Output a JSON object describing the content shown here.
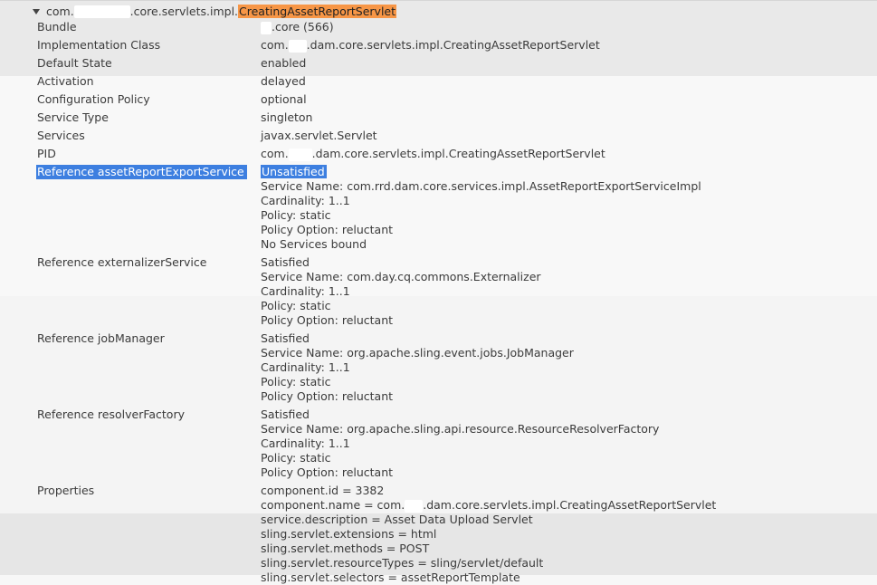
{
  "header": {
    "prefix": "com.",
    "middle": ".core.servlets.impl.",
    "highlight": "CreatingAssetReportServlet"
  },
  "rows": [
    {
      "label": "Bundle",
      "values": [
        {
          "pre": "",
          "redact_w": 12,
          "post": ".core (566)"
        }
      ]
    },
    {
      "label": "Implementation Class",
      "values": [
        {
          "pre": "com.",
          "redact_w": 20,
          "post": ".dam.core.servlets.impl.CreatingAssetReportServlet"
        }
      ]
    },
    {
      "label": "Default State",
      "values": [
        "enabled"
      ]
    },
    {
      "label": "Activation",
      "values": [
        "delayed"
      ]
    },
    {
      "label": "Configuration Policy",
      "values": [
        "optional"
      ]
    },
    {
      "label": "Service Type",
      "values": [
        "singleton"
      ]
    },
    {
      "label": "Services",
      "values": [
        "javax.servlet.Servlet"
      ]
    },
    {
      "label": "PID",
      "values": [
        {
          "pre": "com.",
          "redact_w": 26,
          "post": ".dam.core.servlets.impl.CreatingAssetReportServlet"
        }
      ]
    },
    {
      "label": "Reference assetReportExportService",
      "selected": true,
      "values": [
        {
          "selected_text": "Unsatisfied"
        },
        "Service Name: com.rrd.dam.core.services.impl.AssetReportExportServiceImpl",
        "Cardinality: 1..1",
        "Policy: static",
        "Policy Option: reluctant",
        "No Services bound"
      ]
    },
    {
      "label": "Reference externalizerService",
      "values": [
        "Satisfied",
        "Service Name: com.day.cq.commons.Externalizer",
        "Cardinality: 1..1",
        "Policy: static",
        "Policy Option: reluctant"
      ]
    },
    {
      "label": "Reference jobManager",
      "values": [
        "Satisfied",
        "Service Name: org.apache.sling.event.jobs.JobManager",
        "Cardinality: 1..1",
        "Policy: static",
        "Policy Option: reluctant"
      ]
    },
    {
      "label": "Reference resolverFactory",
      "values": [
        "Satisfied",
        "Service Name: org.apache.sling.api.resource.ResourceResolverFactory",
        "Cardinality: 1..1",
        "Policy: static",
        "Policy Option: reluctant"
      ]
    },
    {
      "label": "Properties",
      "values": [
        "component.id = 3382",
        {
          "pre": "component.name = com.",
          "redact_w": 20,
          "post": ".dam.core.servlets.impl.CreatingAssetReportServlet"
        },
        "service.description = Asset Data Upload Servlet",
        "sling.servlet.extensions = html",
        "sling.servlet.methods = POST",
        "sling.servlet.resourceTypes = sling/servlet/default",
        "sling.servlet.selectors = assetReportTemplate"
      ]
    }
  ]
}
